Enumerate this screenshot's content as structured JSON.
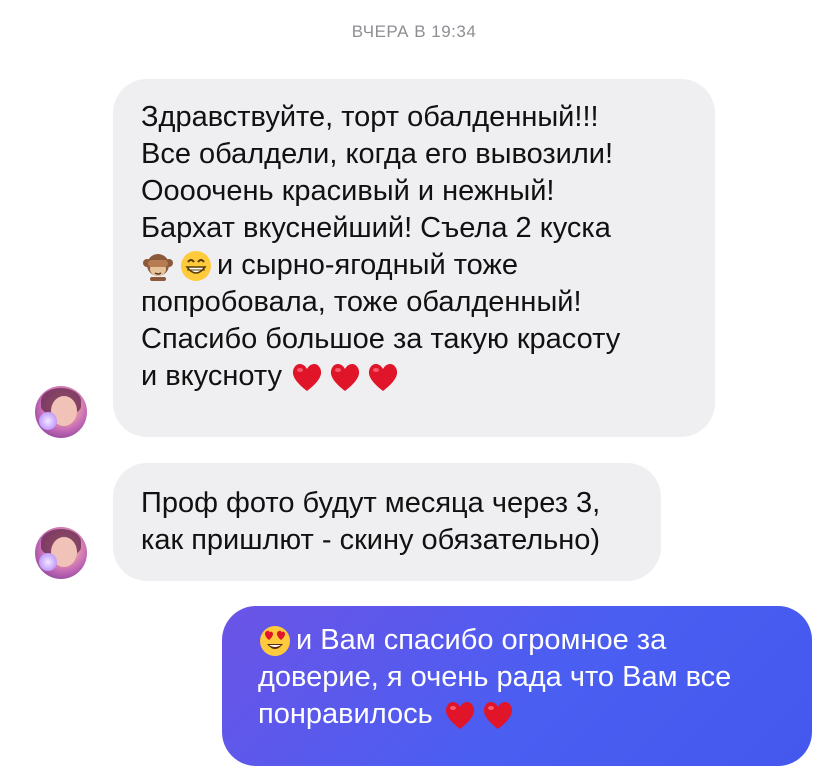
{
  "chat": {
    "timestamp": "ВЧЕРА В 19:34",
    "messages": [
      {
        "direction": "incoming",
        "lines": [
          {
            "text": "Здравствуйте, торт обалденный!!!"
          },
          {
            "text": "Все обалдели, когда его вывозили!"
          },
          {
            "text": "Оооочень красивый и нежный!"
          },
          {
            "text": "Бархат вкуснейший! Съела 2 куска"
          },
          {
            "emojis": [
              "see-no-evil-monkey-emoji",
              "grinning-face-emoji"
            ],
            "text": "и сырно-ягодный тоже"
          },
          {
            "text": "попробовала, тоже обалденный!"
          },
          {
            "text": "Спасибо большое за такую красоту"
          },
          {
            "text": "и вкусноту",
            "trailing_emojis": [
              "red-heart-emoji",
              "red-heart-emoji",
              "red-heart-emoji"
            ]
          }
        ]
      },
      {
        "direction": "incoming",
        "lines": [
          {
            "text": "Проф фото будут месяца через 3,"
          },
          {
            "text": "как пришлют - скину обязательно)"
          }
        ]
      },
      {
        "direction": "outgoing",
        "lines": [
          {
            "emojis": [
              "heart-eyes-emoji"
            ],
            "text": "и Вам спасибо огромное за"
          },
          {
            "text": "доверие, я очень рада что Вам все"
          },
          {
            "text": "понравилось",
            "trailing_emojis": [
              "red-heart-emoji",
              "red-heart-emoji"
            ]
          }
        ]
      }
    ]
  },
  "colors": {
    "incoming_bubble": "#efeff1",
    "outgoing_bubble_start": "#6b54e6",
    "outgoing_bubble_end": "#4458ee",
    "timestamp": "#8e8e93",
    "heart": "#e0152a"
  }
}
